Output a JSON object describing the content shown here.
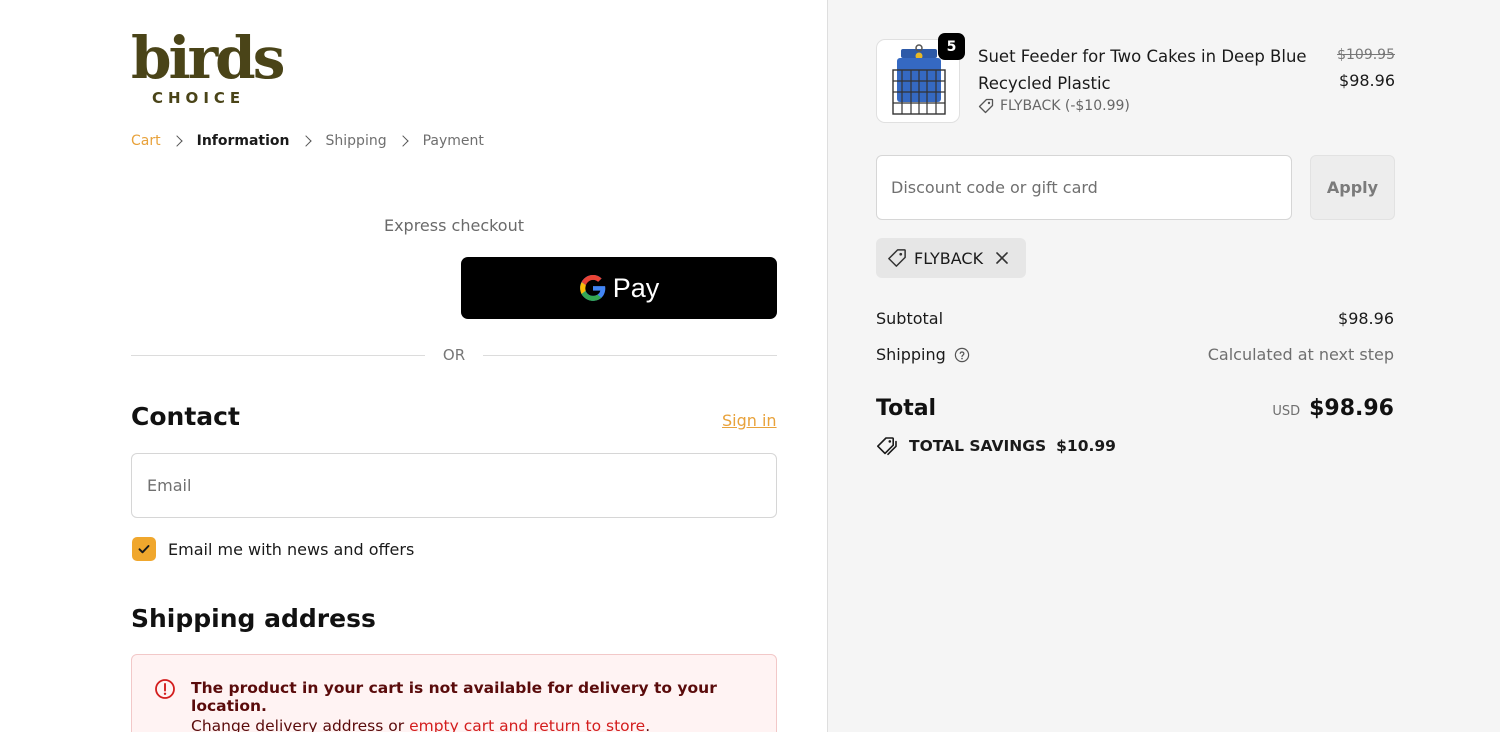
{
  "brand": {
    "name": "birds",
    "subtitle": "CHOICE",
    "color": "#4a4418"
  },
  "breadcrumb": [
    {
      "label": "Cart",
      "state": "link"
    },
    {
      "label": "Information",
      "state": "active"
    },
    {
      "label": "Shipping",
      "state": "inactive"
    },
    {
      "label": "Payment",
      "state": "inactive"
    }
  ],
  "express": {
    "label": "Express checkout",
    "gpay_label": "Pay"
  },
  "divider": {
    "or": "OR"
  },
  "contact": {
    "title": "Contact",
    "sign_in": "Sign in",
    "email_placeholder": "Email",
    "newsletter_label": "Email me with news and offers",
    "newsletter_checked": true
  },
  "shipping": {
    "title": "Shipping address",
    "alert_title": "The product in your cart is not available for delivery to your location.",
    "alert_text_prefix": "Change delivery address or",
    "alert_link": "empty cart and return to store",
    "alert_text_suffix": "."
  },
  "order": {
    "item": {
      "name": "Suet Feeder for Two Cakes in Deep Blue Recycled Plastic",
      "quantity": "5",
      "discount": "FLYBACK (-$10.99)",
      "price_original": "$109.95",
      "price": "$98.96"
    },
    "discount_placeholder": "Discount code or gift card",
    "apply_label": "Apply",
    "applied_code": "FLYBACK",
    "subtotal_label": "Subtotal",
    "subtotal": "$98.96",
    "shipping_label": "Shipping",
    "shipping_value": "Calculated at next step",
    "total_label": "Total",
    "currency": "USD",
    "total": "$98.96",
    "savings_label": "TOTAL SAVINGS",
    "savings": "$10.99"
  },
  "colors": {
    "accent": "#e8a23b",
    "checkbox": "#f0a72d",
    "error_text": "#5a0b0b",
    "error_link": "#d31d1d"
  }
}
